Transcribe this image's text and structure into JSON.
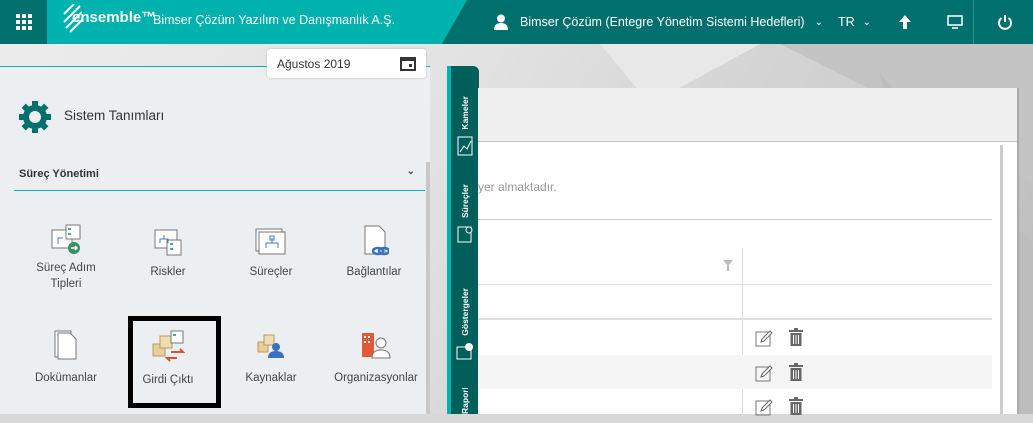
{
  "header": {
    "logo": "ensemble™",
    "company": "Bimser Çözüm Yazılım ve Danışmanlık A.Ş.",
    "user": "Bimser Çözüm (Entegre Yönetim Sistemi Hedefleri)",
    "language": "TR",
    "icons": [
      "apps-grid-icon",
      "user-icon",
      "arrow-up-icon",
      "monitor-icon",
      "power-icon"
    ]
  },
  "date_picker": {
    "value": "Ağustos 2019"
  },
  "left_panel": {
    "title": "Sistem Tanımları",
    "section": "Süreç Yönetimi",
    "tiles": [
      {
        "label": "Süreç Adım Tipleri"
      },
      {
        "label": "Riskler"
      },
      {
        "label": "Süreçler"
      },
      {
        "label": "Bağlantılar"
      },
      {
        "label": "Dokümanlar"
      },
      {
        "label": "Girdi Çıktı"
      },
      {
        "label": "Kaynaklar"
      },
      {
        "label": "Organizasyonlar"
      }
    ]
  },
  "side_tabs": [
    {
      "label": "Kameler"
    },
    {
      "label": "Süreçler"
    },
    {
      "label": "Göstergeler"
    },
    {
      "label": "Raporlar"
    }
  ],
  "main": {
    "message": "yer almaktadır."
  },
  "colors": {
    "teal": "#00b2ad",
    "dark_teal": "#00706e",
    "side": "#005e5b"
  }
}
